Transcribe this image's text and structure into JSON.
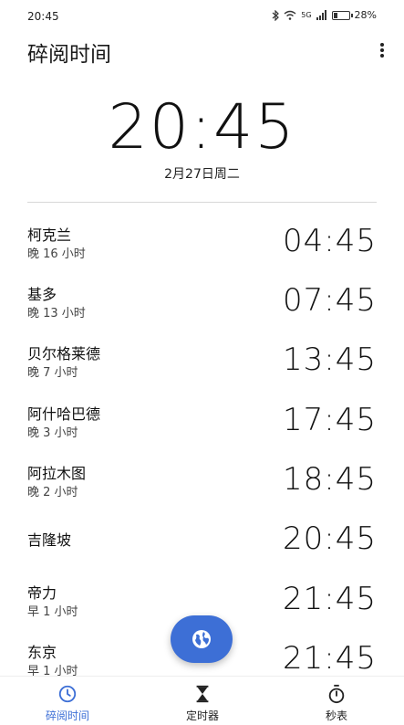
{
  "status": {
    "time": "20:45",
    "network": "5G",
    "battery": "28%",
    "battery_level": 0.28
  },
  "header": {
    "title": "碎阅时间"
  },
  "clock": {
    "time": "20:45",
    "date": "2月27日周二"
  },
  "cities": [
    {
      "name": "柯克兰",
      "offset": "晚 16 小时",
      "time": "04:45"
    },
    {
      "name": "基多",
      "offset": "晚 13 小时",
      "time": "07:45"
    },
    {
      "name": "贝尔格莱德",
      "offset": "晚 7 小时",
      "time": "13:45"
    },
    {
      "name": "阿什哈巴德",
      "offset": "晚 3 小时",
      "time": "17:45"
    },
    {
      "name": "阿拉木图",
      "offset": "晚 2 小时",
      "time": "18:45"
    },
    {
      "name": "吉隆坡",
      "offset": "",
      "time": "20:45"
    },
    {
      "name": "帝力",
      "offset": "早 1 小时",
      "time": "21:45"
    },
    {
      "name": "东京",
      "offset": "早 1 小时",
      "time": "21:45"
    }
  ],
  "fab": {
    "icon": "globe-icon"
  },
  "nav": {
    "items": [
      {
        "label": "碎阅时间",
        "icon": "clock-icon"
      },
      {
        "label": "定时器",
        "icon": "hourglass-icon"
      },
      {
        "label": "秒表",
        "icon": "stopwatch-icon"
      }
    ],
    "active_color": "#3d6fd6"
  }
}
